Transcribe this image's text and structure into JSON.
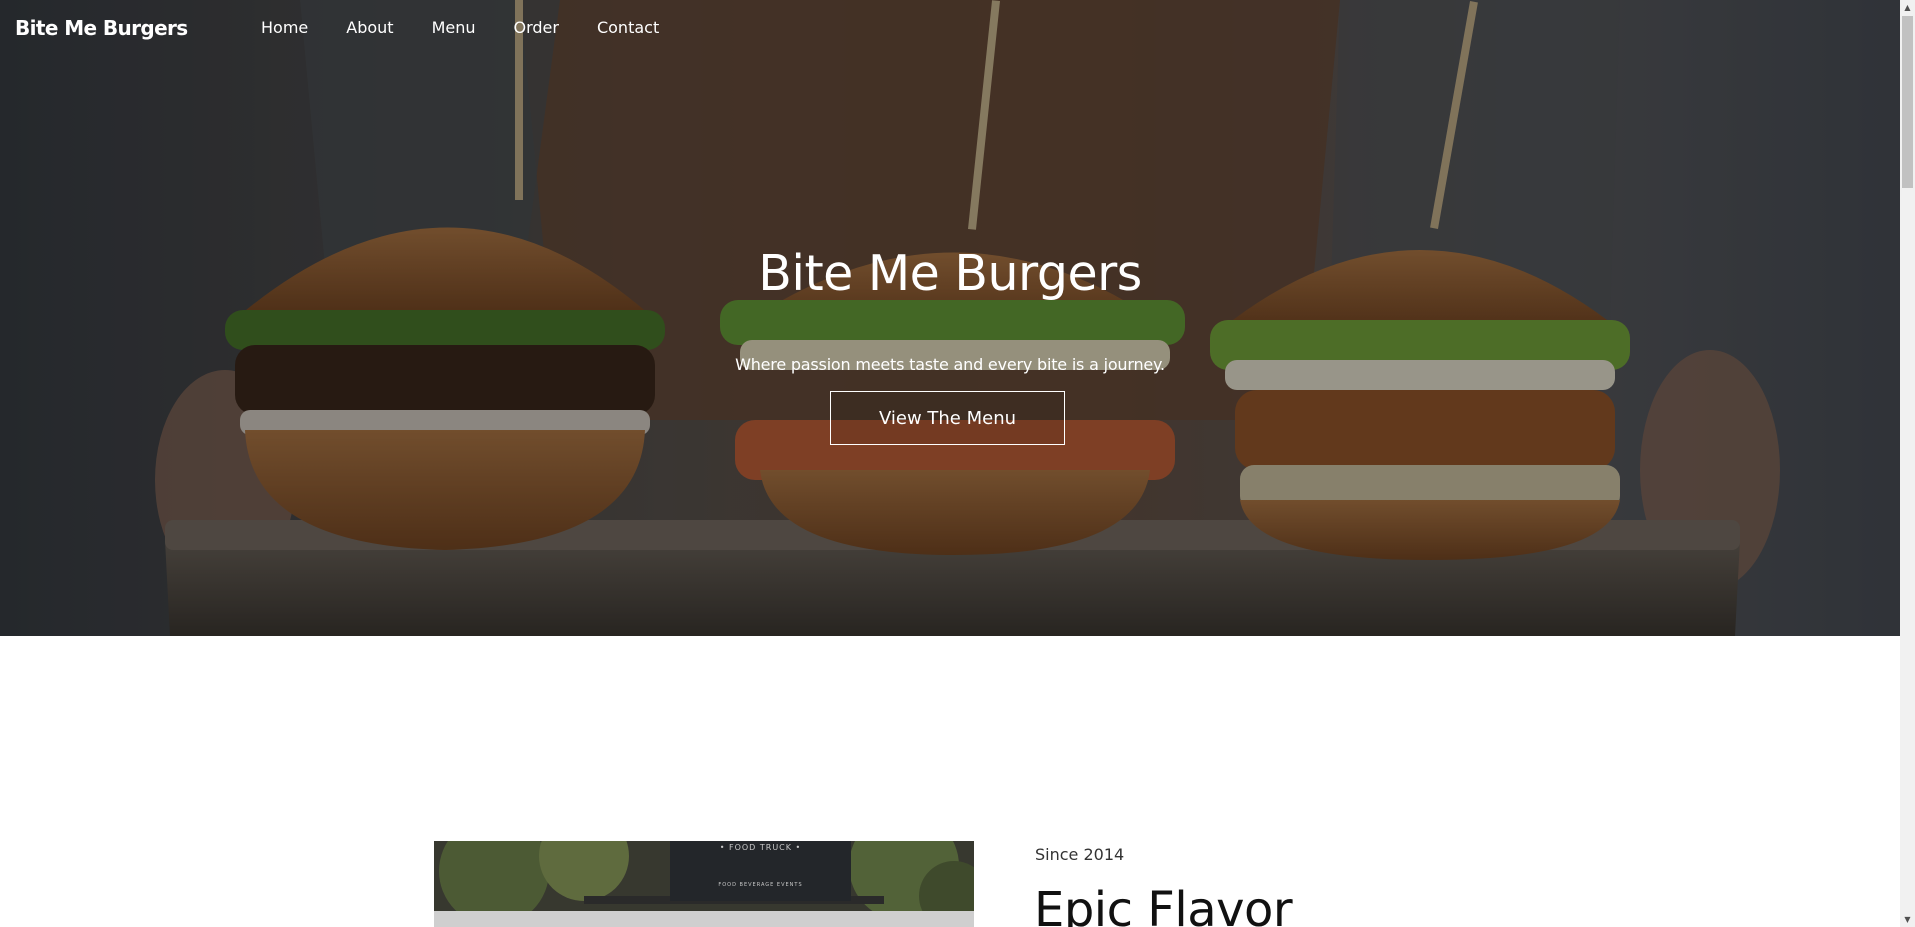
{
  "site": {
    "brand": "Bite Me Burgers"
  },
  "nav": {
    "items": [
      {
        "label": "Home"
      },
      {
        "label": "About"
      },
      {
        "label": "Menu"
      },
      {
        "label": "Order"
      },
      {
        "label": "Contact"
      }
    ]
  },
  "hero": {
    "title": "Bite Me Burgers",
    "tagline": "Where passion meets taste and every bite is a journey.",
    "button_label": "View The Menu"
  },
  "about": {
    "image_sign_title": "• FOOD TRUCK •",
    "image_sign_subtitle": "FOOD  BEVERAGE  EVENTS",
    "since": "Since 2014",
    "heading": "Epic Flavor"
  },
  "colors": {
    "text_on_hero": "#ffffff",
    "page_background": "#ffffff",
    "heading": "#111111"
  },
  "icons": {
    "scroll_up": "triangle-up-icon",
    "scroll_down": "triangle-down-icon"
  }
}
